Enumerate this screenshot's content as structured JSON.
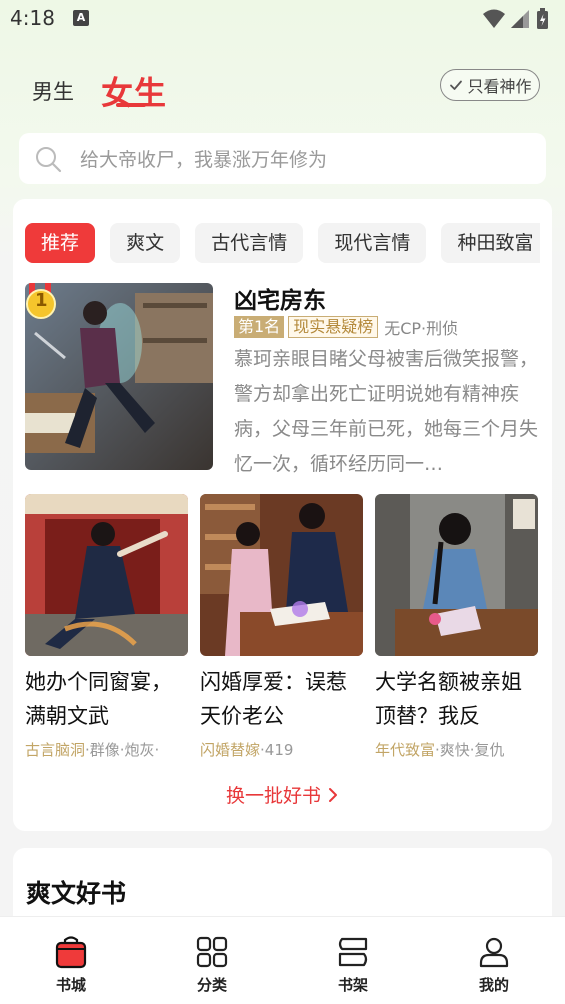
{
  "status_bar": {
    "time": "4:18",
    "notif_letter": "A"
  },
  "header": {
    "gender_tabs": [
      {
        "label": "男生"
      },
      {
        "label": "女生",
        "active": true
      }
    ],
    "only_god_label": "只看神作"
  },
  "search": {
    "placeholder": "给大帝收尸，我暴涨万年修为"
  },
  "categories": [
    "推荐",
    "爽文",
    "古代言情",
    "现代言情",
    "种田致富"
  ],
  "featured": {
    "title": "凶宅房东",
    "rank_badge": "第1名",
    "rank_tag": "现实悬疑榜",
    "meta": "无CP·刑侦",
    "description": "慕珂亲眼目睹父母被害后微笑报警，警方却拿出死亡证明说她有精神疾病，父母三年前已死，她每三个月失忆一次，循环经历同一…",
    "rank_number": "1"
  },
  "books": [
    {
      "title": "她办个同窗宴，满朝文武",
      "tag_main": "古言脑洞",
      "tag_rest": "·群像·炮灰·"
    },
    {
      "title": "闪婚厚爱：误惹天价老公",
      "tag_main": "闪婚替嫁",
      "tag_rest": "·419"
    },
    {
      "title": "大学名额被亲姐顶替？我反",
      "tag_main": "年代致富",
      "tag_rest": "·爽快·复仇"
    }
  ],
  "refresh_label": "换一批好书",
  "section": {
    "title": "爽文好书"
  },
  "bottom_nav": [
    {
      "label": "书城",
      "icon": "bookstore-bag-icon",
      "active": true
    },
    {
      "label": "分类",
      "icon": "grid-icon"
    },
    {
      "label": "书架",
      "icon": "bookshelf-icon"
    },
    {
      "label": "我的",
      "icon": "person-icon"
    }
  ],
  "colors": {
    "accent": "#e8383a",
    "rank_gold": "#c9ad75"
  }
}
